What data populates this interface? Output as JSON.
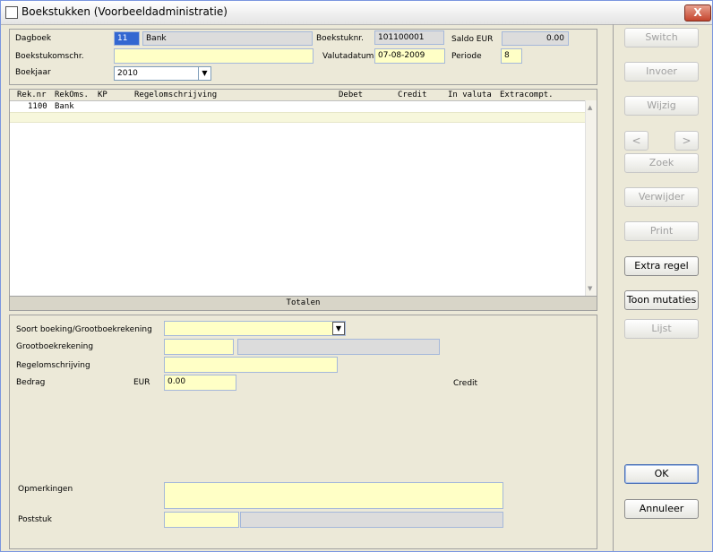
{
  "window": {
    "title": "Boekstukken (Voorbeeldadministratie)",
    "close_label": "X"
  },
  "header": {
    "dagboek_label": "Dagboek",
    "dagboek_code": "11",
    "dagboek_name": "Bank",
    "boekstuknr_label": "Boekstuknr.",
    "boekstuknr_value": "101100001",
    "saldo_label": "Saldo EUR",
    "saldo_value": "0.00",
    "omschr_label": "Boekstukomschr.",
    "omschr_value": "",
    "valutadatum_label": "Valutadatum",
    "valutadatum_value": "07-08-2009",
    "periode_label": "Periode",
    "periode_value": "8",
    "boekjaar_label": "Boekjaar",
    "boekjaar_value": "2010"
  },
  "grid": {
    "columns": [
      "Rek.nr",
      "RekOms.",
      "KP",
      "Regelomschrijving",
      "Debet",
      "Credit",
      "In valuta",
      "Extracompt."
    ],
    "rows": [
      {
        "reknr": "1100",
        "rekoms": "Bank"
      }
    ],
    "footer": "Totalen"
  },
  "detail": {
    "soort_label": "Soort boeking/Grootboekrekening",
    "soort_value": "",
    "grootboek_label": "Grootboekrekening",
    "grootboek_value": "",
    "grootboek_name": "",
    "regel_label": "Regelomschrijving",
    "regel_value": "",
    "bedrag_label": "Bedrag",
    "currency_label": "EUR",
    "bedrag_value": "0.00",
    "credit_label": "Credit",
    "opmerkingen_label": "Opmerkingen",
    "opmerkingen_value": "",
    "poststuk_label": "Poststuk",
    "poststuk_value": "",
    "poststuk_name": ""
  },
  "buttons": {
    "switch": "Switch",
    "invoer": "Invoer",
    "wijzig": "Wijzig",
    "prev": "<",
    "next": ">",
    "zoek": "Zoek",
    "verwijder": "Verwijder",
    "print": "Print",
    "extra_regel": "Extra regel",
    "toon_mutaties": "Toon mutaties",
    "lijst": "Lijst",
    "ok": "OK",
    "annuleer": "Annuleer"
  },
  "icons": {
    "dropdown": "chevron-down-icon",
    "scroll_up": "arrow-up-icon",
    "scroll_down": "arrow-down-icon"
  }
}
